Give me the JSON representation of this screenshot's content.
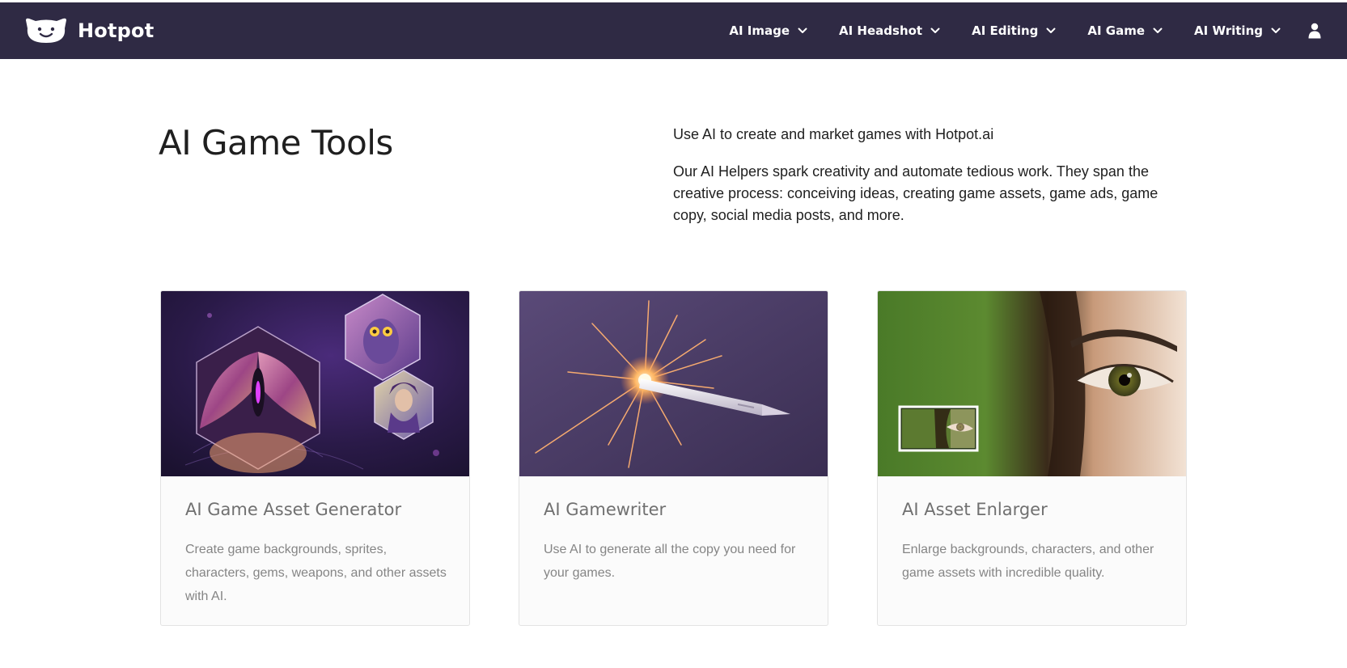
{
  "brand": {
    "name": "Hotpot"
  },
  "nav": {
    "items": [
      {
        "label": "AI Image"
      },
      {
        "label": "AI Headshot"
      },
      {
        "label": "AI Editing"
      },
      {
        "label": "AI Game"
      },
      {
        "label": "AI Writing"
      }
    ],
    "icons": {
      "dropdown": "chevron-down-icon",
      "account": "user-icon",
      "logo": "hotpot-logo-icon"
    }
  },
  "hero": {
    "title": "AI Game Tools",
    "lead": "Use AI to create and market games with Hotpot.ai",
    "body": "Our AI Helpers spark creativity and automate tedious work. They span the creative process: conceiving ideas, creating game assets, game ads, game copy, social media posts, and more."
  },
  "cards": [
    {
      "title": "AI Game Asset Generator",
      "description": "Create game backgrounds, sprites, characters, gems, weapons, and other assets with AI.",
      "image": "fantasy-hexagon-art"
    },
    {
      "title": "AI Gamewriter",
      "description": "Use AI to generate all the copy you need for your games.",
      "image": "sparkling-pen"
    },
    {
      "title": "AI Asset Enlarger",
      "description": "Enlarge backgrounds, characters, and other game assets with incredible quality.",
      "image": "eye-closeup-zoom"
    }
  ],
  "colors": {
    "navbar": "#2f2a44",
    "text": "#1f1f1f",
    "card_title": "#707070",
    "card_text": "#858585",
    "card_border": "#e3e3e3"
  }
}
